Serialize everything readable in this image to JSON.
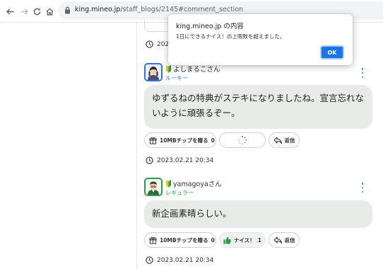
{
  "browser": {
    "url_host": "king.mineo.jp",
    "url_path": "/staff_blogs/2145#comment_section"
  },
  "dialog": {
    "title": "king.mineo.jp の内容",
    "message": "1日にできるナイス！の上限数を超えました。",
    "ok_label": "OK"
  },
  "top_timestamp": "2023.0",
  "comments": [
    {
      "username": "よしまるこさん",
      "rank": "ルーキー",
      "rank_color": "#3a7bd5",
      "avatar_border": "#3a6fd8",
      "text": "ゆずるねの特典がステキになりましたね。宣言忘れないように頑張るぞー。",
      "tip_label": "10MBチップを贈る",
      "tip_count": "0",
      "reply_label": "返信",
      "timestamp": "2023.02.21 20:34"
    },
    {
      "username": "yamagoyaさん",
      "rank": "レギュラー",
      "rank_color": "#2a9b4a",
      "avatar_border": "#2a9b4a",
      "text": "新企画素晴らしい。",
      "tip_label": "10MBチップを贈る",
      "tip_count": "0",
      "nice_label": "ナイス！",
      "nice_count": "1",
      "reply_label": "返信",
      "timestamp": "2023.02.21 20:34"
    }
  ],
  "colors": {
    "accent_green": "#2a9b4a",
    "bubble_bg": "#e8ece9",
    "dialog_button": "#1a73e8"
  }
}
